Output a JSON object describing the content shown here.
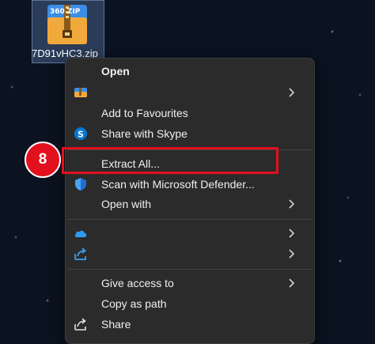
{
  "desktop": {
    "file_label": "7D91vHC3.zip",
    "file_icon_text": "360 ZIP"
  },
  "menu": {
    "items": [
      {
        "name": "open",
        "label": "Open",
        "icon": "none",
        "submenu": false,
        "bold": true
      },
      {
        "name": "open-with-app",
        "label": "",
        "icon": "app-icon",
        "submenu": true
      },
      {
        "name": "add-to-favourites",
        "label": "Add to Favourites",
        "icon": "none",
        "submenu": false
      },
      {
        "name": "share-with-skype",
        "label": "Share with Skype",
        "icon": "skype-icon",
        "submenu": false
      },
      {
        "name": "extract-all",
        "label": "Extract All...",
        "icon": "none",
        "submenu": false
      },
      {
        "name": "scan-defender",
        "label": "Scan with Microsoft Defender...",
        "icon": "defender-shield-icon",
        "submenu": false
      },
      {
        "name": "open-with",
        "label": "Open with",
        "icon": "none",
        "submenu": true
      },
      {
        "name": "onedrive",
        "label": "",
        "icon": "onedrive-cloud-icon",
        "submenu": true
      },
      {
        "name": "share-arrow",
        "label": "",
        "icon": "share-arrow-icon",
        "submenu": true
      },
      {
        "name": "give-access-to",
        "label": "Give access to",
        "icon": "none",
        "submenu": true
      },
      {
        "name": "copy-as-path",
        "label": "Copy as path",
        "icon": "none",
        "submenu": false
      },
      {
        "name": "share",
        "label": "Share",
        "icon": "share-icon",
        "submenu": false
      }
    ]
  },
  "annotation": {
    "step_number": "8",
    "highlight_color": "#e3101e"
  },
  "colors": {
    "menu_background": "#2b2b2b",
    "desktop_background": "#0b1220",
    "skype_blue": "#0078d4",
    "defender_blue": "#1f6fd1"
  }
}
